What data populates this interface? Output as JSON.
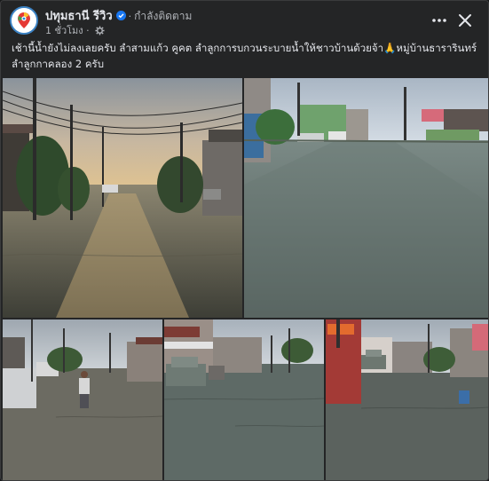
{
  "header": {
    "page_name": "ปทุมธานี รีวิว",
    "separator": "·",
    "follow_label": "กำลังติดตาม",
    "time": "1 ชั่วโมง",
    "privacy_icon": "gear-globe-icon",
    "more_icon": "more-horizontal-icon",
    "close_icon": "close-icon",
    "verified_icon": "verified-badge-icon"
  },
  "post": {
    "caption_line1": "เช้านี้น้ำยังไม่ลงเลยครับ ลำสามแก้ว คูคต ลำลูกการบกวนระบายน้ำให้ชาวบ้านด้วยจ้า🙏หมู่บ้านธารารินทร์",
    "caption_line2": "ลำลูกกาคลอง 2 ครับ"
  },
  "photos": [
    {
      "name": "flooded-street-sunset"
    },
    {
      "name": "flooded-street-daylight"
    },
    {
      "name": "man-wading-flood"
    },
    {
      "name": "flooded-street-cars"
    },
    {
      "name": "flooded-street-red-sign"
    }
  ],
  "colors": {
    "background": "#242526",
    "text": "#e4e6eb",
    "secondary_text": "#b0b3b8",
    "accent": "#1877f2"
  }
}
